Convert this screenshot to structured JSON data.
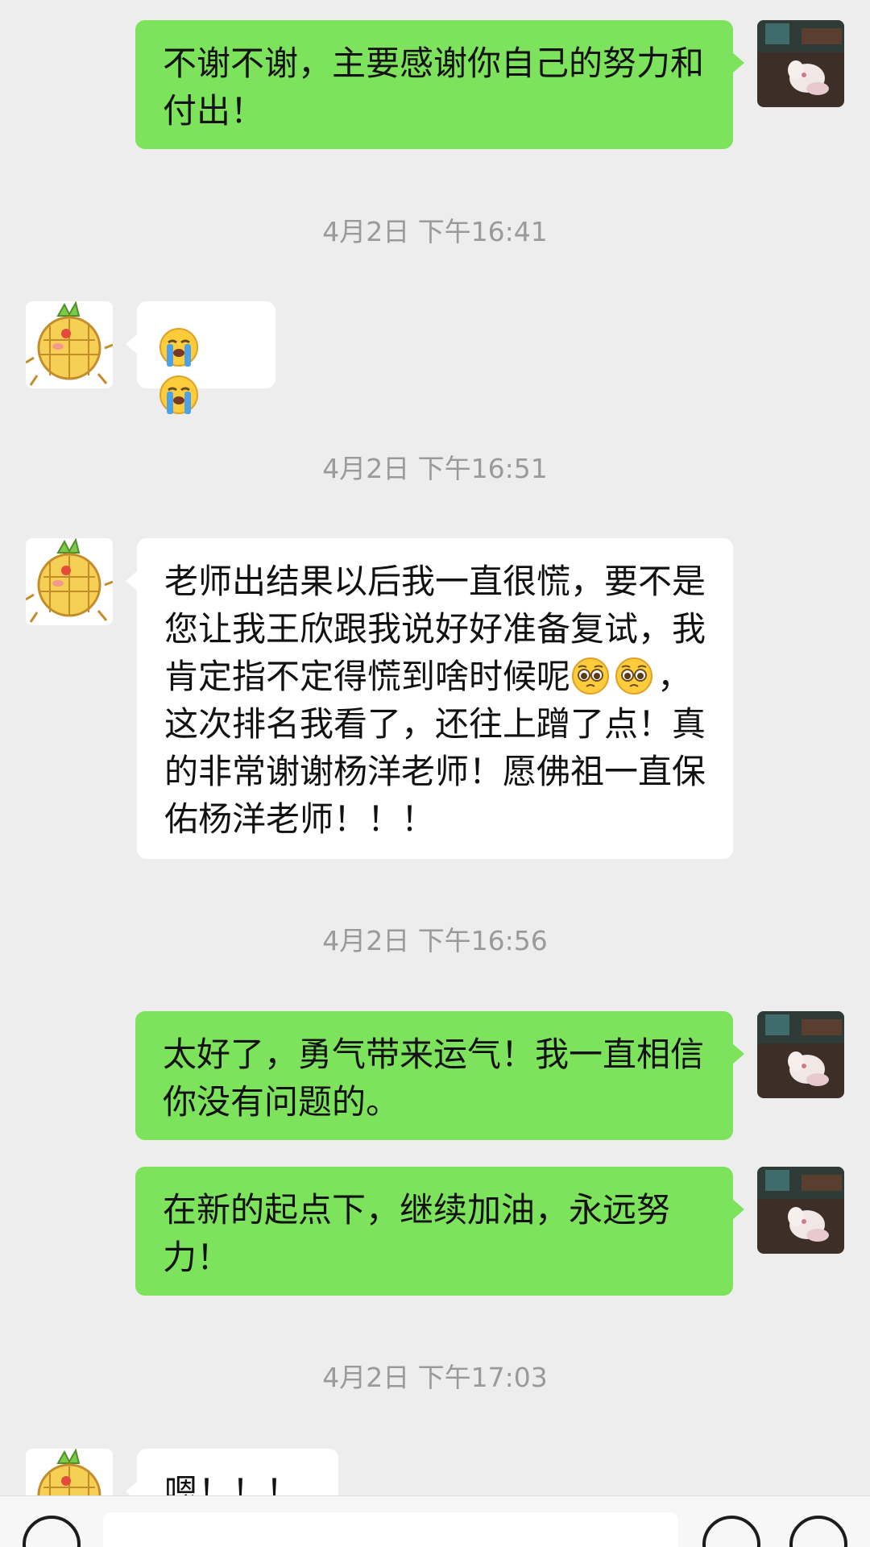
{
  "messages": [
    {
      "kind": "out",
      "text": "不谢不谢，主要感谢你自己的努力和付出！"
    },
    {
      "kind": "time",
      "text": "4月2日 下午16:41"
    },
    {
      "kind": "in",
      "emoji": [
        "loudly-crying-face",
        "loudly-crying-face"
      ]
    },
    {
      "kind": "time",
      "text": "4月2日 下午16:51"
    },
    {
      "kind": "in",
      "text_before": "老师出结果以后我一直很慌，要不是您让我王欣跟我说好好准备复试，我肯定指不定得慌到啥时候呢",
      "emoji": [
        "pleading-face",
        "pleading-face"
      ],
      "text_after": "，这次排名我看了，还往上蹭了点！真的非常谢谢杨洋老师！愿佛祖一直保佑杨洋老师！！！"
    },
    {
      "kind": "time",
      "text": "4月2日 下午16:56"
    },
    {
      "kind": "out",
      "text": "太好了，勇气带来运气！我一直相信你没有问题的。"
    },
    {
      "kind": "out",
      "text": "在新的起点下，继续加油，永远努力！"
    },
    {
      "kind": "time",
      "text": "4月2日 下午17:03"
    },
    {
      "kind": "in",
      "text": "嗯！！！"
    }
  ],
  "input_bar": {
    "left_icon": "voice-icon",
    "right_icons": [
      "emoji-icon",
      "plus-icon"
    ]
  },
  "colors": {
    "outgoing_bubble": "#7de25c",
    "incoming_bubble": "#ffffff",
    "background": "#ededed",
    "timestamp": "#9a9a9a"
  }
}
